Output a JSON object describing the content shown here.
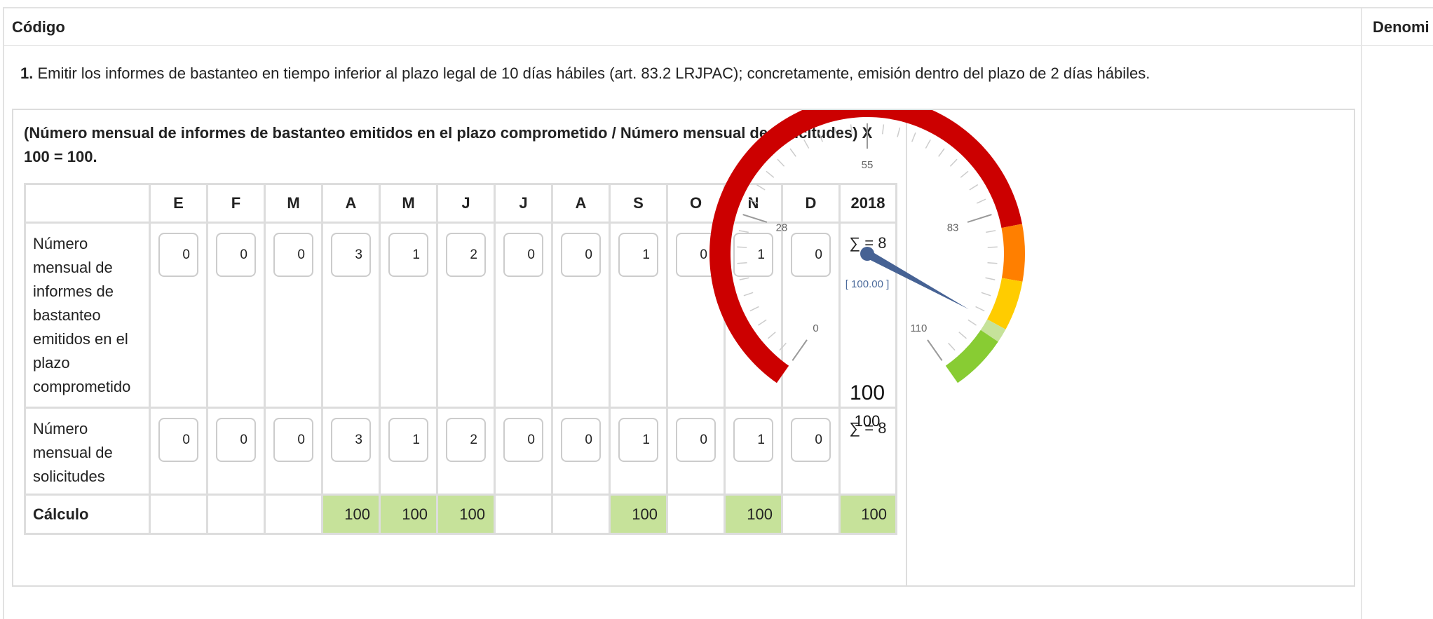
{
  "header": {
    "codigo": "Código",
    "denominacion": "Denomi"
  },
  "objective": {
    "number": "1.",
    "text": " Emitir los informes de bastanteo en tiempo inferior al plazo legal de 10 días hábiles (art. 83.2 LRJPAC); concretamente, emisión dentro del plazo de 2 días hábiles."
  },
  "formula": "(Número mensual de informes de bastanteo emitidos en el plazo comprometido / Número mensual de solicitudes) X 100 = 100.",
  "table": {
    "months": [
      "E",
      "F",
      "M",
      "A",
      "M",
      "J",
      "J",
      "A",
      "S",
      "O",
      "N",
      "D"
    ],
    "year": "2018",
    "row1": {
      "label": "Número mensual de informes de bastanteo emitidos en el plazo comprometido",
      "values": [
        "0",
        "0",
        "0",
        "3",
        "1",
        "2",
        "0",
        "0",
        "1",
        "0",
        "1",
        "0"
      ],
      "sum": "∑ = 8"
    },
    "row2": {
      "label": "Número mensual de solicitudes",
      "values": [
        "0",
        "0",
        "0",
        "3",
        "1",
        "2",
        "0",
        "0",
        "1",
        "0",
        "1",
        "0"
      ],
      "sum": "∑ = 8"
    },
    "calc": {
      "label": "Cálculo",
      "values": [
        "",
        "",
        "",
        "100",
        "100",
        "100",
        "",
        "",
        "100",
        "",
        "100",
        ""
      ],
      "total": "100"
    }
  },
  "gauge": {
    "min": 0,
    "max": 110,
    "value": 100,
    "tick_labels": [
      "0",
      "28",
      "55",
      "83",
      "110"
    ],
    "value_label": "[ 100.00 ]",
    "big_value": "100",
    "small_value": "100",
    "bands": [
      {
        "from": 0,
        "to": 85,
        "color": "#cc0000"
      },
      {
        "from": 85,
        "to": 93,
        "color": "#ff7f00"
      },
      {
        "from": 93,
        "to": 100,
        "color": "#ffcc00"
      },
      {
        "from": 100,
        "to": 102,
        "color": "#c6e29a"
      },
      {
        "from": 102,
        "to": 110,
        "color": "#88cc33"
      }
    ],
    "needle_color": "#466294",
    "label_color": "#666666",
    "value_label_color": "#4b6a9b",
    "highlight_color": "#c6e29a"
  }
}
